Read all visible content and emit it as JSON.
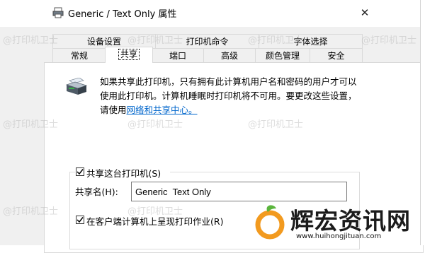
{
  "window": {
    "title": "Generic / Text Only 属性",
    "close_glyph": "✕"
  },
  "tabs_row1": [
    "设备设置",
    "打印机命令",
    "字体选择"
  ],
  "tabs_row2": [
    "常规",
    "共享",
    "端口",
    "高级",
    "颜色管理",
    "安全"
  ],
  "active_tab": "共享",
  "description": {
    "text": "如果共享此打印机，只有拥有此计算机用户名和密码的用户才可以使用此打印机。计算机睡眠时打印机将不可用。要更改这些设置，请使用",
    "link": "网络和共享中心。"
  },
  "share_checkbox": {
    "label": "共享这台打印机(S)",
    "checked": true
  },
  "share_name": {
    "label": "共享名(H):",
    "value": "Generic  Text Only"
  },
  "render_checkbox": {
    "label": "在客户端计算机上呈现打印作业(R)",
    "checked": true
  },
  "watermarks": [
    "@打印机卫士",
    "@打印机卫士",
    "@打印机卫士",
    "@打印机卫士",
    "@打印机卫士",
    "@打印机卫士",
    "@打印机卫士",
    "@打印机卫士",
    "@打印机卫士"
  ],
  "brand": {
    "name": "辉宏资讯网",
    "url": "www.huihongjituan.com"
  },
  "colors": {
    "link": "#0066cc",
    "brand_orange": "#f29a1f",
    "brand_green": "#5bb53d"
  }
}
